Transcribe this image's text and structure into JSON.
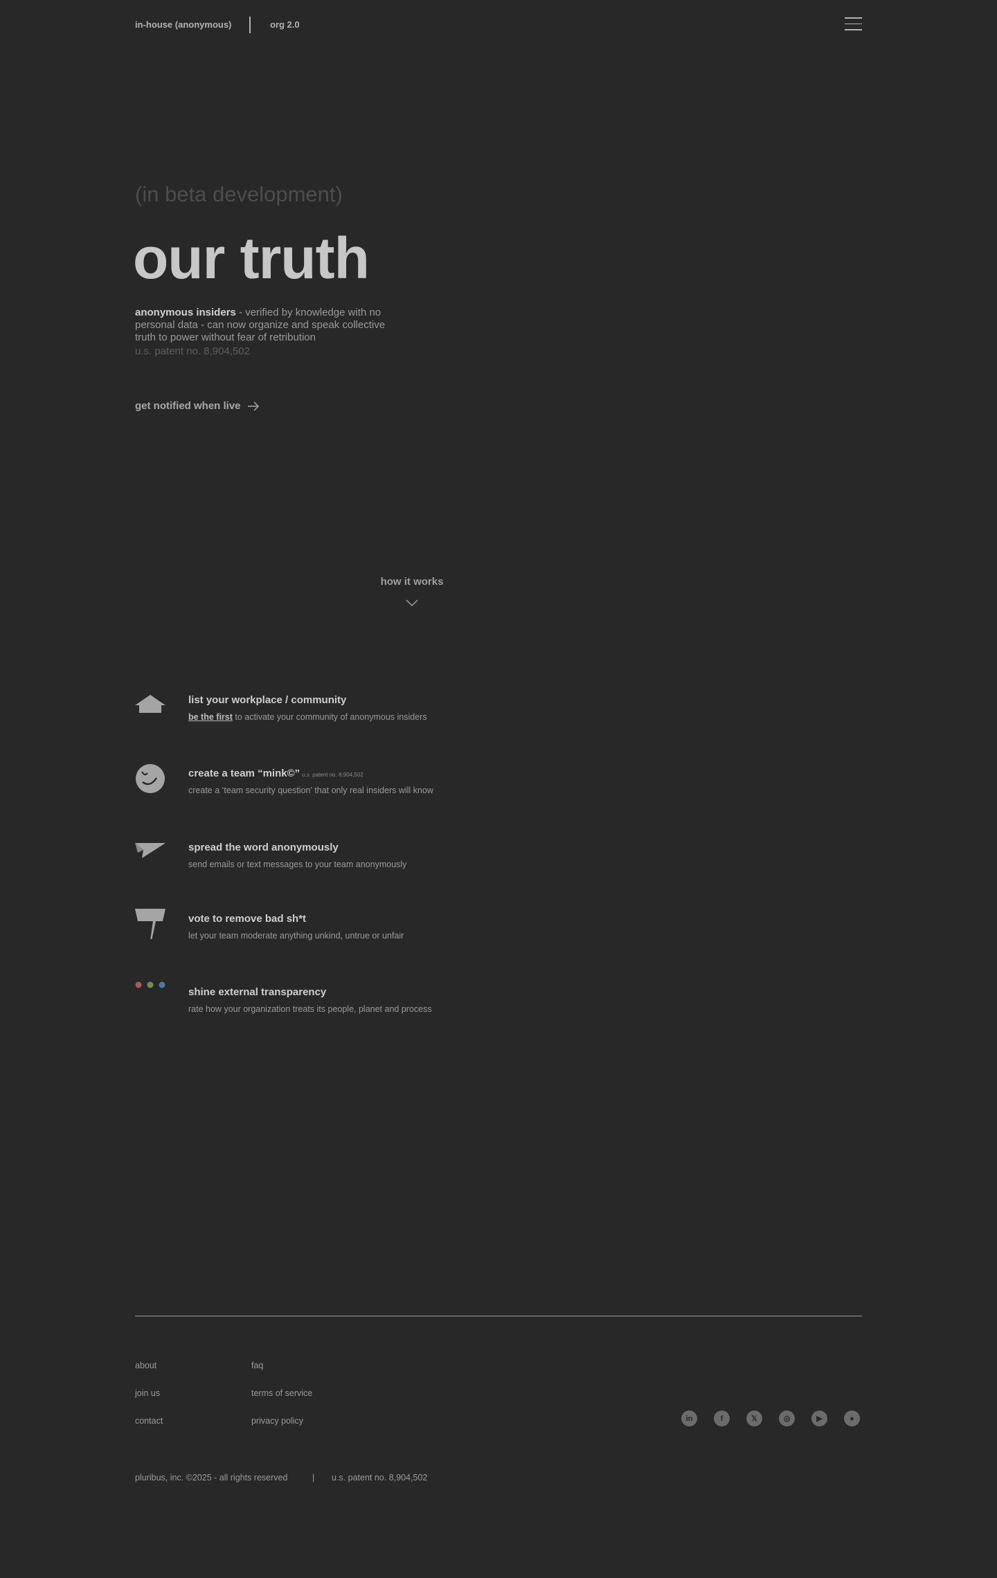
{
  "header": {
    "brand": "in-house (anonymous)",
    "org": "org 2.0",
    "menu_icon": "hamburger-icon"
  },
  "hero": {
    "beta": "(in beta development)",
    "title": "our truth",
    "desc_bold": "anonymous insiders",
    "desc_rest": " - verified by knowledge with no personal data - can now organize and speak collective truth to power without fear of retribution",
    "patent": "u.s. patent no. 8,904,502",
    "notify_label": "get notified when live"
  },
  "how_it_works": {
    "label": "how it works"
  },
  "steps": [
    {
      "icon": "house-icon",
      "title": "list your workplace / community",
      "desc_link": "be the first",
      "desc": " to activate your community of anonymous insiders"
    },
    {
      "icon": "wink-face-icon",
      "title": "create a team “mink©”",
      "title_note": "u.s. patent no. 8,904,502",
      "desc": "create a ‘team security question’ that only real insiders will know"
    },
    {
      "icon": "paper-plane-icon",
      "title": "spread the word anonymously",
      "desc": "send emails or text messages to your team anonymously"
    },
    {
      "icon": "flag-icon",
      "title": "vote to remove bad sh*t",
      "desc": "let your team moderate anything unkind, untrue or unfair"
    },
    {
      "icon": "three-dots-icon",
      "title": "shine external transparency",
      "desc": "rate how your organization treats its people, planet and process",
      "dot_colors": [
        "#a85c5c",
        "#6b8f4e",
        "#4f7aa3"
      ]
    }
  ],
  "footer": {
    "col1": [
      "about",
      "join us",
      "contact"
    ],
    "col2": [
      "faq",
      "terms of service",
      "privacy policy"
    ],
    "socials": [
      "linkedin-icon",
      "facebook-icon",
      "x-icon",
      "instagram-icon",
      "youtube-icon",
      "reddit-icon"
    ],
    "social_glyphs": [
      "in",
      "f",
      "𝕏",
      "◎",
      "▶",
      "●"
    ],
    "copyright": "pluribus, inc. ©2025 - all rights reserved",
    "separator": "|",
    "patent": "u.s. patent no. 8,904,502"
  }
}
